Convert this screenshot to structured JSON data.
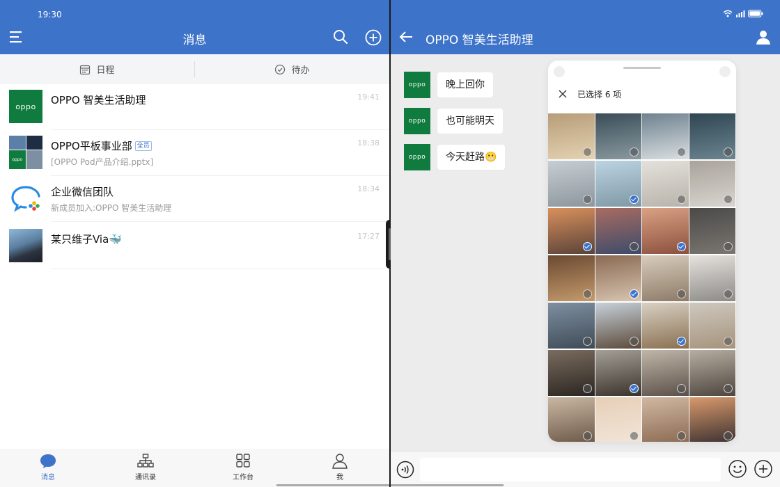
{
  "status": {
    "time": "19:30"
  },
  "left": {
    "title": "消息",
    "tabs": [
      {
        "label": "日程",
        "icon": "calendar-icon"
      },
      {
        "label": "待办",
        "icon": "check-circle-icon"
      }
    ],
    "conversations": [
      {
        "name": "OPPO 智美生活助理",
        "sub": "",
        "time": "19:41",
        "logo": "oppo"
      },
      {
        "name": "OPPO平板事业部",
        "badge": "全员",
        "sub": "[OPPO Pod产品介绍.pptx]",
        "time": "18:38"
      },
      {
        "name": "企业微信团队",
        "sub": "新成员加入:OPPO 智美生活助理",
        "time": "18:34"
      },
      {
        "name": "某只维子Via🐳",
        "sub": "",
        "time": "17:27"
      }
    ],
    "nav": [
      {
        "label": "消息",
        "icon": "chat-bubble-icon",
        "active": true
      },
      {
        "label": "通讯录",
        "icon": "org-chart-icon"
      },
      {
        "label": "工作台",
        "icon": "grid-icon"
      },
      {
        "label": "我",
        "icon": "person-icon"
      }
    ]
  },
  "right": {
    "title": "OPPO 智美生活助理",
    "messages": [
      {
        "text": "晚上回你"
      },
      {
        "text": "也可能明天"
      },
      {
        "text": "今天赶路😬"
      }
    ],
    "picker": {
      "selected_label": "已选择 6 项",
      "photos": [
        {
          "c": "#b79d79",
          "c2": "#e4d2b2",
          "sel": false
        },
        {
          "c": "#3a4d58",
          "c2": "#8a9aa0",
          "sel": false
        },
        {
          "c": "#6f8290",
          "c2": "#d9dee0",
          "sel": false
        },
        {
          "c": "#2f4552",
          "c2": "#6c8591",
          "sel": false
        },
        {
          "c": "#c7ced3",
          "c2": "#8c969c",
          "sel": false
        },
        {
          "c": "#bcd4e2",
          "c2": "#7f98a5",
          "sel": true
        },
        {
          "c": "#e4e1dc",
          "c2": "#b8b3aa",
          "sel": false
        },
        {
          "c": "#a9a39a",
          "c2": "#d8d4cf",
          "sel": false
        },
        {
          "c": "#d9905c",
          "c2": "#5a4339",
          "sel": true
        },
        {
          "c": "#a86c61",
          "c2": "#3d4b6a",
          "sel": false
        },
        {
          "c": "#d9a184",
          "c2": "#8c503d",
          "sel": true
        },
        {
          "c": "#4b4a48",
          "c2": "#7a7670",
          "sel": false
        },
        {
          "c": "#6b4a32",
          "c2": "#c49a6c",
          "sel": false
        },
        {
          "c": "#8a6a52",
          "c2": "#d8c5b1",
          "sel": true
        },
        {
          "c": "#d8ccbd",
          "c2": "#8c7a66",
          "sel": false
        },
        {
          "c": "#e6e3df",
          "c2": "#8c8a86",
          "sel": false
        },
        {
          "c": "#7e8fa0",
          "c2": "#3f4b57",
          "sel": false
        },
        {
          "c": "#c6d1da",
          "c2": "#5c4a3a",
          "sel": false
        },
        {
          "c": "#d8d0c4",
          "c2": "#8a7050",
          "sel": true
        },
        {
          "c": "#cfc8bf",
          "c2": "#a5937c",
          "sel": false
        },
        {
          "c": "#7a6c5f",
          "c2": "#2b2621",
          "sel": false
        },
        {
          "c": "#a5a097",
          "c2": "#3a332c",
          "sel": true
        },
        {
          "c": "#c0b6a8",
          "c2": "#5b514a",
          "sel": false
        },
        {
          "c": "#b7aea2",
          "c2": "#4e463f",
          "sel": false
        },
        {
          "c": "#c9b7a3",
          "c2": "#6d5848",
          "sel": false
        },
        {
          "c": "#e7cfb8",
          "c2": "#f1e5d8",
          "sel": false
        },
        {
          "c": "#d1b8a2",
          "c2": "#8a6a52",
          "sel": false
        },
        {
          "c": "#d9996c",
          "c2": "#3b3131",
          "sel": false
        }
      ]
    },
    "input": {
      "placeholder": ""
    }
  },
  "colors": {
    "brand_blue": "#3d73c9",
    "oppo_green": "#107b3e"
  }
}
